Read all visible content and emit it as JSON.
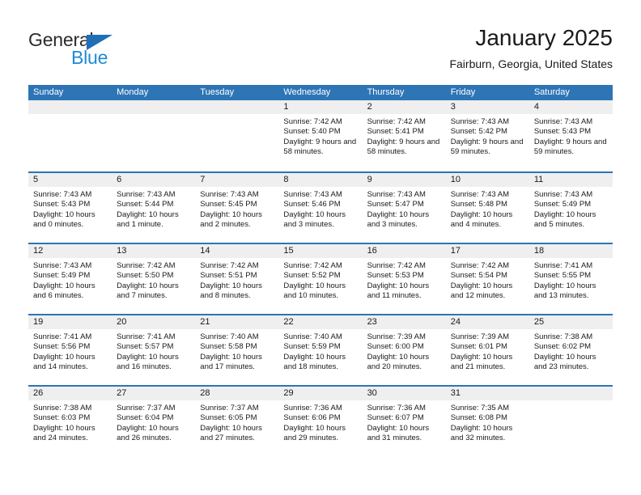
{
  "brand": {
    "name_primary": "General",
    "name_secondary": "Blue",
    "primary_color": "#2b2b2b",
    "secondary_color": "#1f8ad6",
    "triangle_color": "#1f6fb5"
  },
  "header": {
    "title": "January 2025",
    "subtitle": "Fairburn, Georgia, United States"
  },
  "theme": {
    "header_blue": "#2e75b6",
    "date_band_gray": "#efefef",
    "text_color": "#1a1a1a"
  },
  "weekdays": [
    "Sunday",
    "Monday",
    "Tuesday",
    "Wednesday",
    "Thursday",
    "Friday",
    "Saturday"
  ],
  "weeks": [
    [
      {
        "day": "",
        "empty": true,
        "sunrise": "",
        "sunset": "",
        "daylight": ""
      },
      {
        "day": "",
        "empty": true,
        "sunrise": "",
        "sunset": "",
        "daylight": ""
      },
      {
        "day": "",
        "empty": true,
        "sunrise": "",
        "sunset": "",
        "daylight": ""
      },
      {
        "day": "1",
        "empty": false,
        "sunrise": "Sunrise: 7:42 AM",
        "sunset": "Sunset: 5:40 PM",
        "daylight": "Daylight: 9 hours and 58 minutes."
      },
      {
        "day": "2",
        "empty": false,
        "sunrise": "Sunrise: 7:42 AM",
        "sunset": "Sunset: 5:41 PM",
        "daylight": "Daylight: 9 hours and 58 minutes."
      },
      {
        "day": "3",
        "empty": false,
        "sunrise": "Sunrise: 7:43 AM",
        "sunset": "Sunset: 5:42 PM",
        "daylight": "Daylight: 9 hours and 59 minutes."
      },
      {
        "day": "4",
        "empty": false,
        "sunrise": "Sunrise: 7:43 AM",
        "sunset": "Sunset: 5:43 PM",
        "daylight": "Daylight: 9 hours and 59 minutes."
      }
    ],
    [
      {
        "day": "5",
        "empty": false,
        "sunrise": "Sunrise: 7:43 AM",
        "sunset": "Sunset: 5:43 PM",
        "daylight": "Daylight: 10 hours and 0 minutes."
      },
      {
        "day": "6",
        "empty": false,
        "sunrise": "Sunrise: 7:43 AM",
        "sunset": "Sunset: 5:44 PM",
        "daylight": "Daylight: 10 hours and 1 minute."
      },
      {
        "day": "7",
        "empty": false,
        "sunrise": "Sunrise: 7:43 AM",
        "sunset": "Sunset: 5:45 PM",
        "daylight": "Daylight: 10 hours and 2 minutes."
      },
      {
        "day": "8",
        "empty": false,
        "sunrise": "Sunrise: 7:43 AM",
        "sunset": "Sunset: 5:46 PM",
        "daylight": "Daylight: 10 hours and 3 minutes."
      },
      {
        "day": "9",
        "empty": false,
        "sunrise": "Sunrise: 7:43 AM",
        "sunset": "Sunset: 5:47 PM",
        "daylight": "Daylight: 10 hours and 3 minutes."
      },
      {
        "day": "10",
        "empty": false,
        "sunrise": "Sunrise: 7:43 AM",
        "sunset": "Sunset: 5:48 PM",
        "daylight": "Daylight: 10 hours and 4 minutes."
      },
      {
        "day": "11",
        "empty": false,
        "sunrise": "Sunrise: 7:43 AM",
        "sunset": "Sunset: 5:49 PM",
        "daylight": "Daylight: 10 hours and 5 minutes."
      }
    ],
    [
      {
        "day": "12",
        "empty": false,
        "sunrise": "Sunrise: 7:43 AM",
        "sunset": "Sunset: 5:49 PM",
        "daylight": "Daylight: 10 hours and 6 minutes."
      },
      {
        "day": "13",
        "empty": false,
        "sunrise": "Sunrise: 7:42 AM",
        "sunset": "Sunset: 5:50 PM",
        "daylight": "Daylight: 10 hours and 7 minutes."
      },
      {
        "day": "14",
        "empty": false,
        "sunrise": "Sunrise: 7:42 AM",
        "sunset": "Sunset: 5:51 PM",
        "daylight": "Daylight: 10 hours and 8 minutes."
      },
      {
        "day": "15",
        "empty": false,
        "sunrise": "Sunrise: 7:42 AM",
        "sunset": "Sunset: 5:52 PM",
        "daylight": "Daylight: 10 hours and 10 minutes."
      },
      {
        "day": "16",
        "empty": false,
        "sunrise": "Sunrise: 7:42 AM",
        "sunset": "Sunset: 5:53 PM",
        "daylight": "Daylight: 10 hours and 11 minutes."
      },
      {
        "day": "17",
        "empty": false,
        "sunrise": "Sunrise: 7:42 AM",
        "sunset": "Sunset: 5:54 PM",
        "daylight": "Daylight: 10 hours and 12 minutes."
      },
      {
        "day": "18",
        "empty": false,
        "sunrise": "Sunrise: 7:41 AM",
        "sunset": "Sunset: 5:55 PM",
        "daylight": "Daylight: 10 hours and 13 minutes."
      }
    ],
    [
      {
        "day": "19",
        "empty": false,
        "sunrise": "Sunrise: 7:41 AM",
        "sunset": "Sunset: 5:56 PM",
        "daylight": "Daylight: 10 hours and 14 minutes."
      },
      {
        "day": "20",
        "empty": false,
        "sunrise": "Sunrise: 7:41 AM",
        "sunset": "Sunset: 5:57 PM",
        "daylight": "Daylight: 10 hours and 16 minutes."
      },
      {
        "day": "21",
        "empty": false,
        "sunrise": "Sunrise: 7:40 AM",
        "sunset": "Sunset: 5:58 PM",
        "daylight": "Daylight: 10 hours and 17 minutes."
      },
      {
        "day": "22",
        "empty": false,
        "sunrise": "Sunrise: 7:40 AM",
        "sunset": "Sunset: 5:59 PM",
        "daylight": "Daylight: 10 hours and 18 minutes."
      },
      {
        "day": "23",
        "empty": false,
        "sunrise": "Sunrise: 7:39 AM",
        "sunset": "Sunset: 6:00 PM",
        "daylight": "Daylight: 10 hours and 20 minutes."
      },
      {
        "day": "24",
        "empty": false,
        "sunrise": "Sunrise: 7:39 AM",
        "sunset": "Sunset: 6:01 PM",
        "daylight": "Daylight: 10 hours and 21 minutes."
      },
      {
        "day": "25",
        "empty": false,
        "sunrise": "Sunrise: 7:38 AM",
        "sunset": "Sunset: 6:02 PM",
        "daylight": "Daylight: 10 hours and 23 minutes."
      }
    ],
    [
      {
        "day": "26",
        "empty": false,
        "sunrise": "Sunrise: 7:38 AM",
        "sunset": "Sunset: 6:03 PM",
        "daylight": "Daylight: 10 hours and 24 minutes."
      },
      {
        "day": "27",
        "empty": false,
        "sunrise": "Sunrise: 7:37 AM",
        "sunset": "Sunset: 6:04 PM",
        "daylight": "Daylight: 10 hours and 26 minutes."
      },
      {
        "day": "28",
        "empty": false,
        "sunrise": "Sunrise: 7:37 AM",
        "sunset": "Sunset: 6:05 PM",
        "daylight": "Daylight: 10 hours and 27 minutes."
      },
      {
        "day": "29",
        "empty": false,
        "sunrise": "Sunrise: 7:36 AM",
        "sunset": "Sunset: 6:06 PM",
        "daylight": "Daylight: 10 hours and 29 minutes."
      },
      {
        "day": "30",
        "empty": false,
        "sunrise": "Sunrise: 7:36 AM",
        "sunset": "Sunset: 6:07 PM",
        "daylight": "Daylight: 10 hours and 31 minutes."
      },
      {
        "day": "31",
        "empty": false,
        "sunrise": "Sunrise: 7:35 AM",
        "sunset": "Sunset: 6:08 PM",
        "daylight": "Daylight: 10 hours and 32 minutes."
      },
      {
        "day": "",
        "empty": true,
        "sunrise": "",
        "sunset": "",
        "daylight": ""
      }
    ]
  ]
}
